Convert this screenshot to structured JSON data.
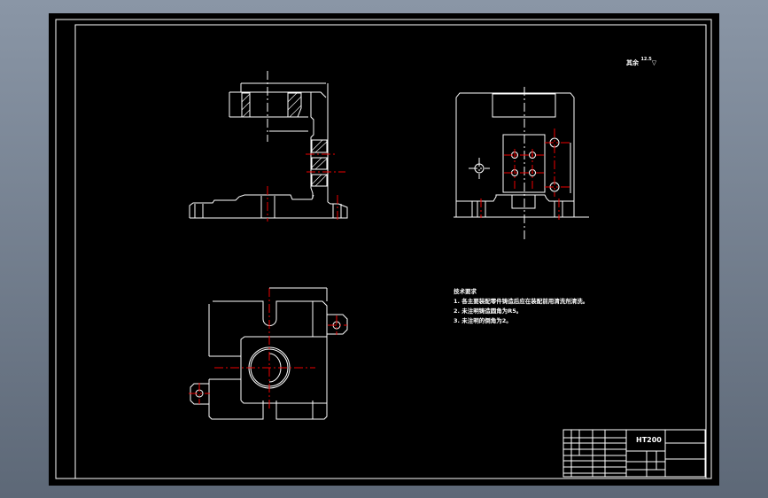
{
  "drawing": {
    "surface_note": {
      "label": "其余",
      "roughness": "12.5"
    },
    "technical_requirements": {
      "title": "技术要求",
      "items": [
        "1. 各主要装配零件铸造后应在装配前用清洗剂清洗。",
        "2. 未注明铸造圆角为R5。",
        "3. 未注明的倒角为2。"
      ]
    },
    "title_block": {
      "material": "HT200"
    },
    "colors": {
      "background": "#000000",
      "lines": "#ffffff",
      "centerlines": "#ee0000",
      "frame": "#7a8696"
    }
  }
}
